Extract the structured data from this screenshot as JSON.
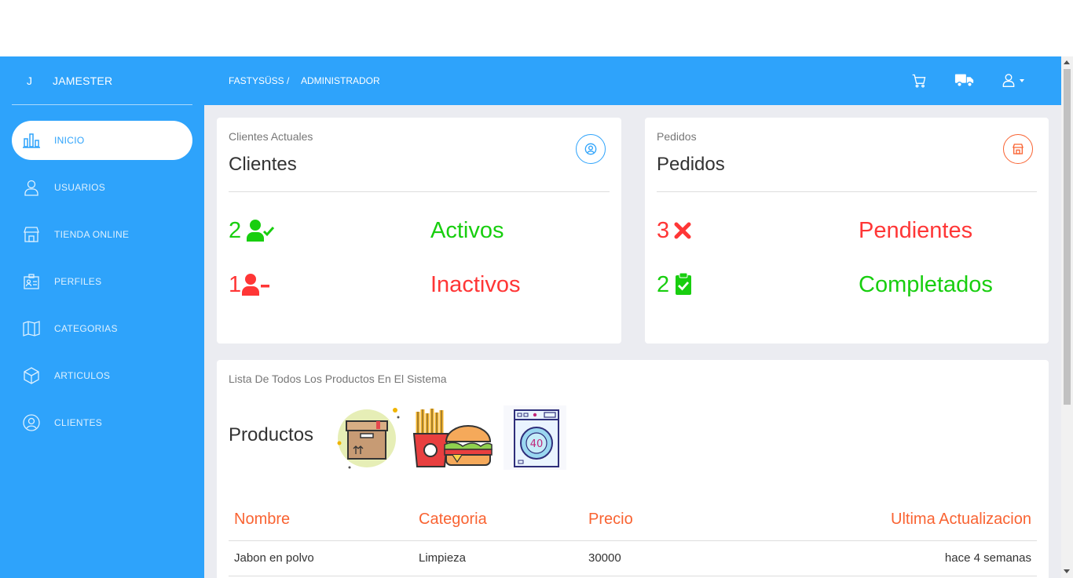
{
  "brand": {
    "mini": "J",
    "name": "JAMESTER"
  },
  "sidebar": {
    "items": [
      {
        "label": "INICIO",
        "icon": "chart-bar-icon",
        "active": true
      },
      {
        "label": "USUARIOS",
        "icon": "user-icon"
      },
      {
        "label": "TIENDA ONLINE",
        "icon": "store-icon"
      },
      {
        "label": "PERFILES",
        "icon": "id-card-icon"
      },
      {
        "label": "CATEGORIAS",
        "icon": "map-icon"
      },
      {
        "label": "ARTICULOS",
        "icon": "box-icon"
      },
      {
        "label": "CLIENTES",
        "icon": "user-circle-icon"
      }
    ]
  },
  "breadcrumb": {
    "first": "FASTYSÜSS /",
    "second": "ADMINISTRADOR"
  },
  "topbar_icons": [
    "cart-icon",
    "truck-icon",
    "user-dropdown-icon"
  ],
  "clients_card": {
    "category": "Clientes Actuales",
    "title": "Clientes",
    "active_count": "2",
    "active_label": "Activos",
    "inactive_count": "1",
    "inactive_label": "Inactivos"
  },
  "orders_card": {
    "category": "Pedidos",
    "title": "Pedidos",
    "pending_count": "3",
    "pending_label": "Pendientes",
    "completed_count": "2",
    "completed_label": "Completados"
  },
  "products_card": {
    "category": "Lista De Todos Los Productos En El Sistema",
    "title": "Productos",
    "images": [
      "box-illustration",
      "fast-food-illustration",
      "washing-machine-illustration"
    ],
    "columns": [
      "Nombre",
      "Categoria",
      "Precio",
      "Ultima Actualizacion"
    ],
    "rows": [
      {
        "nombre": "Jabon en polvo",
        "categoria": "Limpieza",
        "precio": "30000",
        "actualizacion": "hace 4 semanas"
      }
    ]
  },
  "colors": {
    "primary": "#2ea3fb",
    "success": "#18ce0f",
    "danger": "#ff3636",
    "accent": "#f96332"
  }
}
